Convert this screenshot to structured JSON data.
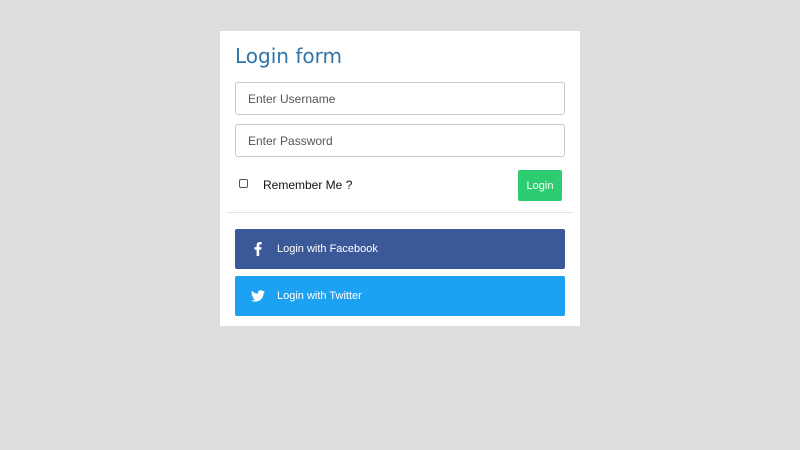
{
  "form": {
    "title": "Login form",
    "username": {
      "value": "",
      "placeholder": "Enter Username"
    },
    "password": {
      "value": "",
      "placeholder": "Enter Password"
    },
    "remember_label": "Remember Me ?",
    "remember_checked": false,
    "login_label": "Login"
  },
  "social": {
    "facebook": {
      "label": "Login with Facebook",
      "icon": "facebook-icon",
      "color": "#3b5998"
    },
    "twitter": {
      "label": "Login with Twitter",
      "icon": "twitter-icon",
      "color": "#1da1f2"
    }
  },
  "colors": {
    "title": "#2f75a8",
    "login_button": "#2ecc71",
    "background": "#dddddd"
  }
}
